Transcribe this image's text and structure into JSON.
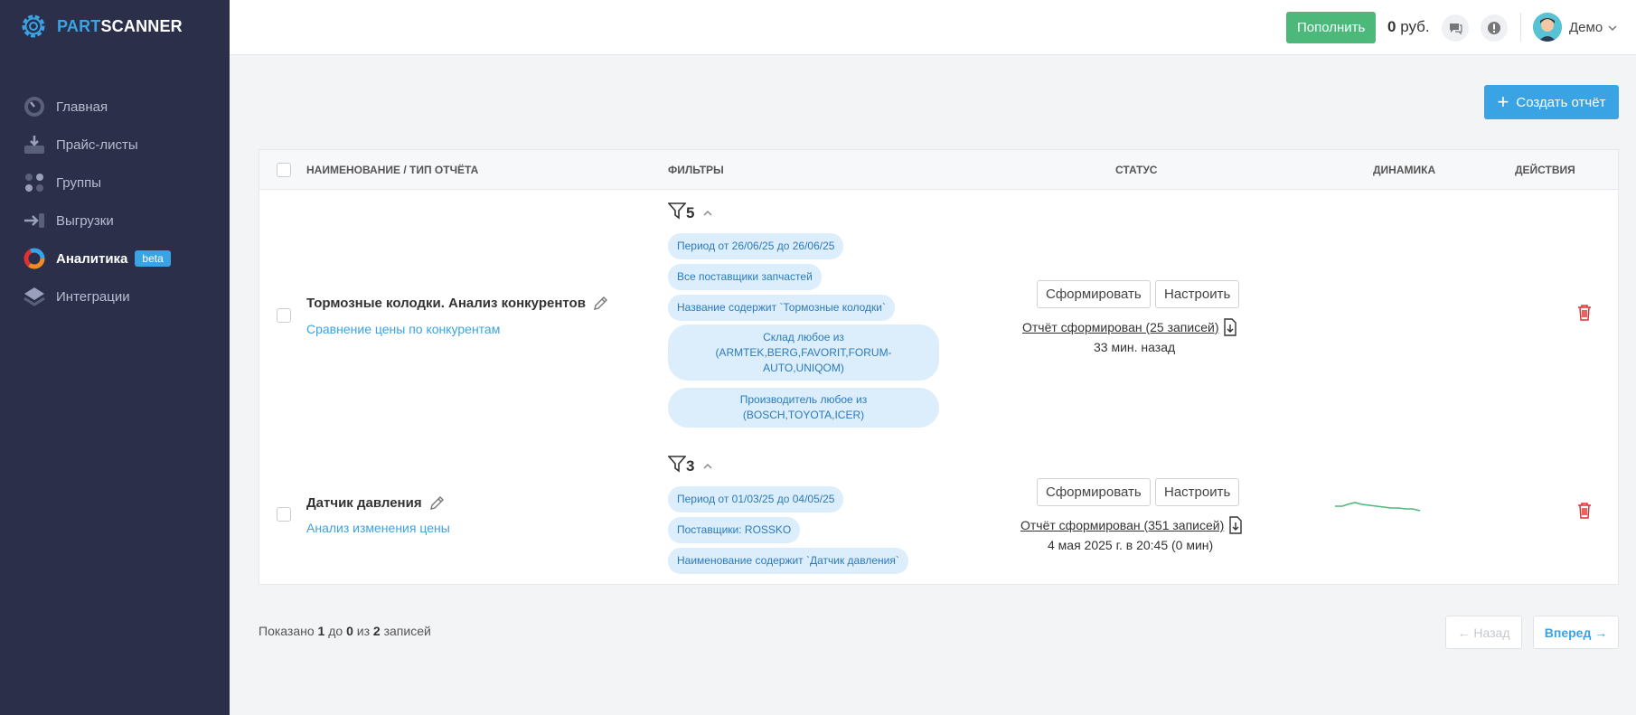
{
  "brand": {
    "part": "PART",
    "scanner": "SCANNER"
  },
  "sidebar": {
    "items": [
      {
        "label": "Главная",
        "icon": "dashboard-icon"
      },
      {
        "label": "Прайс-листы",
        "icon": "tray-download-icon"
      },
      {
        "label": "Группы",
        "icon": "dots-grid-icon"
      },
      {
        "label": "Выгрузки",
        "icon": "export-arrow-icon"
      },
      {
        "label": "Аналитика",
        "icon": "donut-chart-icon",
        "badge": "beta",
        "active": true
      },
      {
        "label": "Интеграции",
        "icon": "layers-icon"
      }
    ]
  },
  "header": {
    "topup_label": "Пополнить",
    "balance_amount": "0",
    "balance_currency": "руб.",
    "user_name": "Демо"
  },
  "toolbar": {
    "create_label": "Создать отчёт"
  },
  "table": {
    "columns": {
      "name": "НАИМЕНОВАНИЕ / ТИП ОТЧЁТА",
      "filters": "ФИЛЬТРЫ",
      "status": "СТАТУС",
      "dynamics": "ДИНАМИКА",
      "actions": "ДЕЙСТВИЯ"
    },
    "rows": [
      {
        "name": "Тормозные колодки. Анализ конкурентов",
        "type": "Сравнение цены по конкурентам",
        "filter_count": "5",
        "filters": [
          "Период от 26/06/25 до 26/06/25",
          "Все поставщики запчастей",
          "Название содержит `Тормозные колодки`",
          "Склад любое из (ARMTEK,BERG,FAVORIT,FORUM-AUTO,UNIQOM)",
          "Производитель любое из (BOSCH,TOYOTA,ICER)"
        ],
        "generate_label": "Сформировать",
        "configure_label": "Настроить",
        "report_status": "Отчёт сформирован (25 записей)",
        "report_time": "33 мин. назад"
      },
      {
        "name": "Датчик давления",
        "type": "Анализ изменения цены",
        "filter_count": "3",
        "filters": [
          "Период от 01/03/25 до 04/05/25",
          "Поставщики: ROSSKO",
          "Наименование содержит `Датчик давления`"
        ],
        "generate_label": "Сформировать",
        "configure_label": "Настроить",
        "report_status": "Отчёт сформирован (351 записей)",
        "report_time": "4 мая 2025 г. в 20:45 (0 мин)"
      }
    ]
  },
  "pagination": {
    "shown": "Показано",
    "from": "1",
    "to_word": "до",
    "to": "0",
    "of_word": "из",
    "total": "2",
    "records_word": "записей",
    "prev_label": "← Назад",
    "next_label": "Вперед →"
  },
  "colors": {
    "sidebar_bg": "#2b2f4a",
    "accent": "#3aa3e3",
    "topup_green": "#4cb97a",
    "danger": "#e03131",
    "tag_bg": "#dcedfb"
  }
}
